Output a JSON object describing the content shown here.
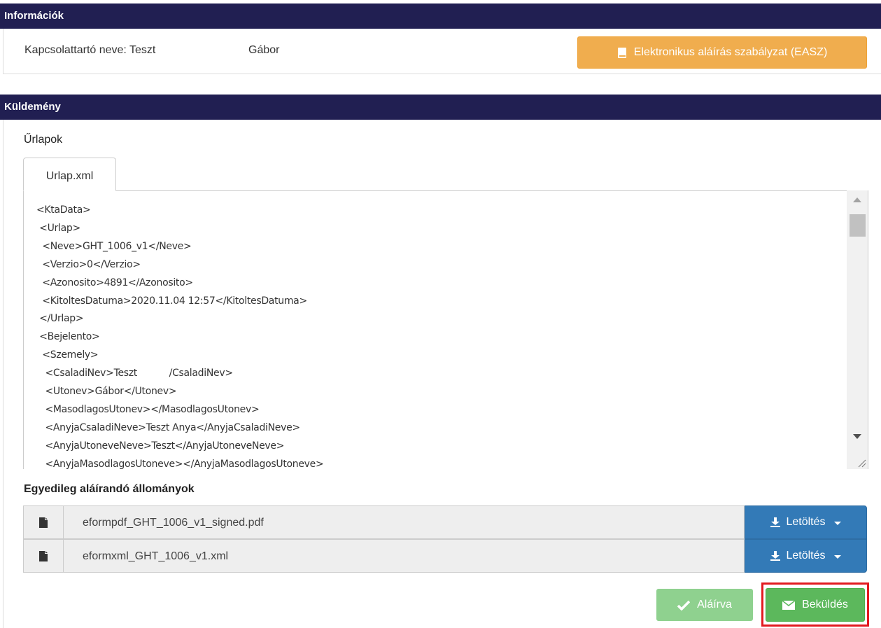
{
  "info": {
    "title": "Információk",
    "contact_label": "Kapcsolattartó neve: Teszt",
    "contact_given": "Gábor",
    "easz_button": "Elektronikus aláírás szabályzat (EASZ)",
    "easz_icon": "book-icon"
  },
  "send": {
    "title": "Küldemény",
    "forms_label": "Űrlapok",
    "tab_label": "Urlap.xml",
    "xml_text": "<KtaData>\n <Urlap>\n  <Neve>GHT_1006_v1</Neve>\n  <Verzio>0</Verzio>\n  <Azonosito>4891</Azonosito>\n  <KitoltesDatuma>2020.11.04 12:57</KitoltesDatuma>\n </Urlap>\n <Bejelento>\n  <Szemely>\n   <CsaladiNev>Teszt           /CsaladiNev>\n   <Utonev>Gábor</Utonev>\n   <MasodlagosUtonev></MasodlagosUtonev>\n   <AnyjaCsaladiNeve>Teszt Anya</AnyjaCsaladiNeve>\n   <AnyjaUtoneveNeve>Teszt</AnyjaUtoneveNeve>\n   <AnyjaMasodlagosUtoneve></AnyjaMasodlagosUtoneve>",
    "files_label": "Egyedileg aláírandó állományok",
    "files": [
      {
        "name": "eformpdf_GHT_1006_v1_signed.pdf",
        "button": "Letöltés"
      },
      {
        "name": "eformxml_GHT_1006_v1.xml",
        "button": "Letöltés"
      }
    ],
    "signed_button": "Aláírva",
    "submit_button": "Beküldés"
  },
  "colors": {
    "header_bg": "#211f52",
    "warning": "#f0ad4e",
    "primary": "#337ab7",
    "success": "#5cb85c",
    "highlight": "#e21a1f"
  }
}
